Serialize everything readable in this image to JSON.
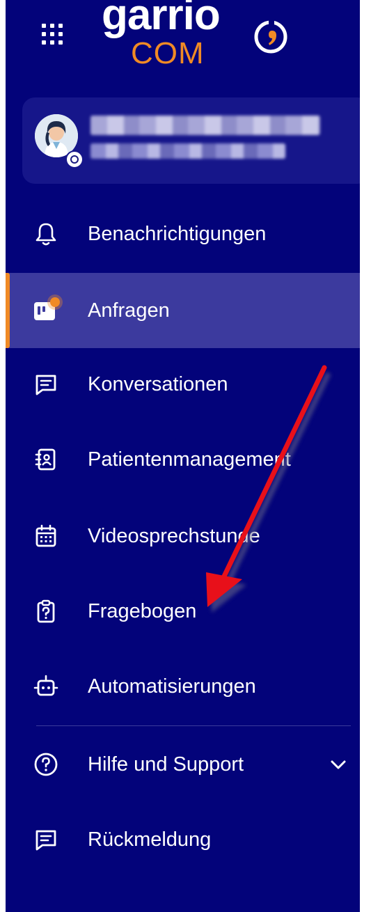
{
  "logo": {
    "line1": "garrio",
    "line2": "COM"
  },
  "colors": {
    "sidebar_bg": "#03037a",
    "active_bg": "#3c3a9e",
    "accent": "#f08a25",
    "annotation_arrow": "#e8101a"
  },
  "header": {
    "apps_icon": "grid-icon"
  },
  "nav": {
    "notifications": {
      "label": "Benachrichtigungen",
      "icon": "bell-icon"
    },
    "requests": {
      "label": "Anfragen",
      "icon": "board-icon",
      "active": true
    },
    "conversations": {
      "label": "Konversationen",
      "icon": "message-icon"
    },
    "patients": {
      "label": "Patientenmanagement",
      "icon": "contacts-book-icon"
    },
    "video": {
      "label": "Videosprechstunde",
      "icon": "calendar-icon"
    },
    "questionnaire": {
      "label": "Fragebogen",
      "icon": "clipboard-question-icon"
    },
    "automations": {
      "label": "Automatisierungen",
      "icon": "robot-icon"
    }
  },
  "footer_nav": {
    "help": {
      "label": "Hilfe und Support",
      "icon": "help-circle-icon",
      "toggle_icon": "chevron-down-icon"
    },
    "feedback": {
      "label": "Rückmeldung",
      "icon": "message-icon"
    }
  }
}
